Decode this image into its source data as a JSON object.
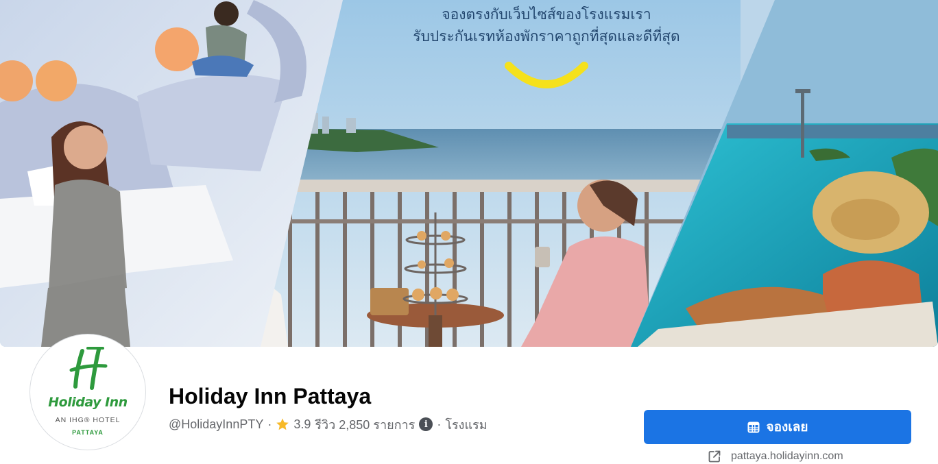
{
  "cover": {
    "headline_line1": "จองตรงกับเว็บไซส์ของโรงแรมเรา",
    "headline_line2": "รับประกันเรทห้องพักราคาถูกที่สุดและดีที่สุด",
    "accent_color": "#f5e11c"
  },
  "logo": {
    "brand": "Holiday Inn",
    "tagline": "AN IHG® HOTEL",
    "city": "PATTAYA",
    "brand_color": "#2e9a3d"
  },
  "page": {
    "title": "Holiday Inn Pattaya",
    "handle": "@HolidayInnPTY",
    "rating": "3.9",
    "reviews_label": "รีวิว 2,850 รายการ",
    "category": "โรงแรม"
  },
  "actions": {
    "book_label": "จองเลย",
    "book_color": "#1b74e4",
    "website": "pattaya.holidayinn.com"
  },
  "icons": {
    "rating": "star-icon",
    "info": "info-icon",
    "book": "calendar-icon",
    "website": "external-link-icon"
  }
}
